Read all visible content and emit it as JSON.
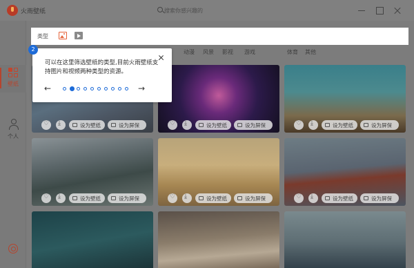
{
  "app": {
    "title": "火雨壁纸"
  },
  "search": {
    "placeholder": "搜索你感兴趣的"
  },
  "sidebar": {
    "items": [
      {
        "label": "壁纸",
        "icon": "grid-icon",
        "active": true
      },
      {
        "label": "个人",
        "icon": "person-icon",
        "active": false
      }
    ],
    "settings_icon": "settings-icon"
  },
  "filter": {
    "type_label": "类型",
    "types": [
      {
        "icon": "image-icon",
        "selected": true
      },
      {
        "icon": "video-icon",
        "selected": false
      }
    ],
    "categories": [
      "动漫",
      "风景",
      "影视",
      "游戏",
      "体育",
      "其他"
    ]
  },
  "tooltip": {
    "step": "2",
    "text": "可以在这里筛选壁纸的类型,目前火雨壁纸支持图片和视频两种类型的资源。",
    "total_steps": 10,
    "current_step_index": 1
  },
  "card_actions": {
    "set_wallpaper": "设为壁纸",
    "set_screensaver": "设为屏保"
  },
  "colors": {
    "accent": "#b6452e",
    "tooltip_accent": "#1d6bd8"
  }
}
